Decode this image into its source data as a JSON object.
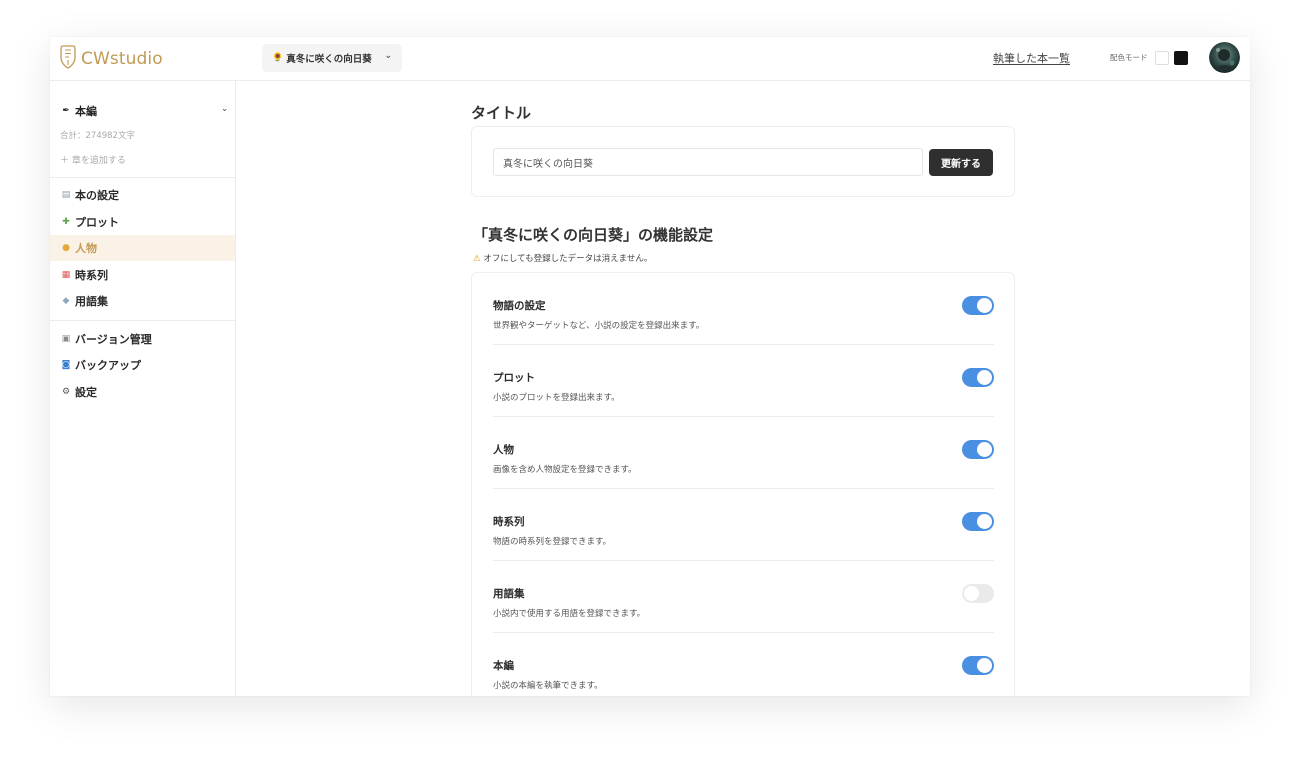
{
  "header": {
    "logo_text": "CWstudio",
    "book_select": {
      "icon": "sunflower-icon",
      "value": "真冬に咲くの向日葵"
    },
    "written_books_link": "執筆した本一覧",
    "color_mode_label": "配色モード",
    "avatar": "user-avatar"
  },
  "sidebar": {
    "section": {
      "icon": "pen-icon",
      "label": "本編"
    },
    "total": "合計：274982文字",
    "add_chapter": "＋ 章を追加する",
    "items": [
      {
        "icon": "memo-icon",
        "label": "本の設定",
        "active": false
      },
      {
        "icon": "puzzle-icon",
        "label": "プロット",
        "active": false
      },
      {
        "icon": "person-icon",
        "label": "人物",
        "active": true
      },
      {
        "icon": "calendar-icon",
        "label": "時系列",
        "active": false
      },
      {
        "icon": "label-icon",
        "label": "用語集",
        "active": false
      }
    ],
    "items2": [
      {
        "icon": "archive-icon",
        "label": "バージョン管理"
      },
      {
        "icon": "backup-icon",
        "label": "バックアップ"
      },
      {
        "icon": "gear-icon",
        "label": "設定"
      }
    ]
  },
  "main": {
    "title_section": {
      "heading": "タイトル",
      "input_value": "真冬に咲くの向日葵",
      "update_button": "更新する"
    },
    "features": {
      "heading": "「真冬に咲くの向日葵」の機能設定",
      "warning": "オフにしても登録したデータは消えません。",
      "rows": [
        {
          "name": "物語の設定",
          "desc": "世界観やターゲットなど、小説の設定を登録出来ます。",
          "enabled": true
        },
        {
          "name": "プロット",
          "desc": "小説のプロットを登録出来ます。",
          "enabled": true
        },
        {
          "name": "人物",
          "desc": "画像を含め人物設定を登録できます。",
          "enabled": true
        },
        {
          "name": "時系列",
          "desc": "物語の時系列を登録できます。",
          "enabled": true
        },
        {
          "name": "用語集",
          "desc": "小説内で使用する用語を登録できます。",
          "enabled": false
        },
        {
          "name": "本編",
          "desc": "小説の本編を執筆できます。",
          "enabled": true
        }
      ]
    }
  },
  "colors": {
    "accent": "#c29a54",
    "toggle_on": "#4a90e2",
    "active_bg": "#fbf2e7",
    "button_dark": "#2f2f2f"
  }
}
